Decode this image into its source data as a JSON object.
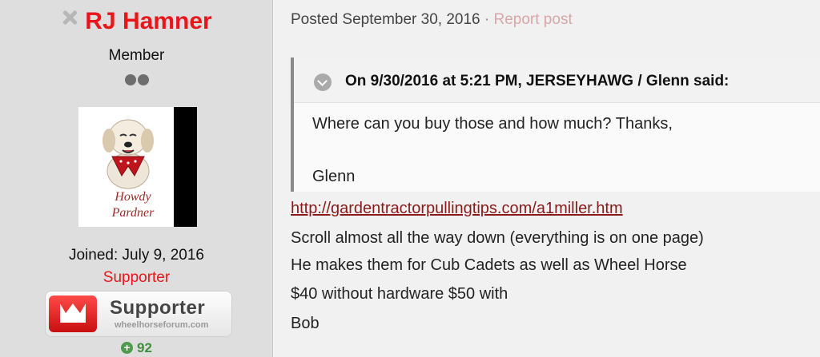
{
  "author": {
    "name": "RJ Hamner",
    "status_icon": "offline-x-icon",
    "group": "Member",
    "joined": "Joined: July 9, 2016",
    "title": "Supporter",
    "avatar": {
      "line1": "Howdy",
      "line2": "Pardner"
    },
    "badge": {
      "label": "Supporter",
      "site": "wheelhorseforum.com"
    },
    "reputation": "92"
  },
  "post": {
    "posted": "Posted September 30, 2016",
    "separator": "·",
    "report_label": "Report post",
    "quote": {
      "citation": "On 9/30/2016 at 5:21 PM, JERSEYHAWG / Glenn said:",
      "line1": "Where can you buy those and how much? Thanks,",
      "line2": "Glenn"
    },
    "link": "http://gardentractorpullingtips.com/a1miller.htm",
    "lines": [
      "Scroll almost all the way down (everything is on one page)",
      "He makes them for Cub Cadets as well as Wheel Horse",
      "$40 without hardware $50 with",
      "Bob"
    ]
  },
  "colors": {
    "name_red": "#e8161b",
    "link_red": "#8b1a1a",
    "report_pink": "#d6a7a7",
    "rep_green": "#3f8f3f"
  }
}
